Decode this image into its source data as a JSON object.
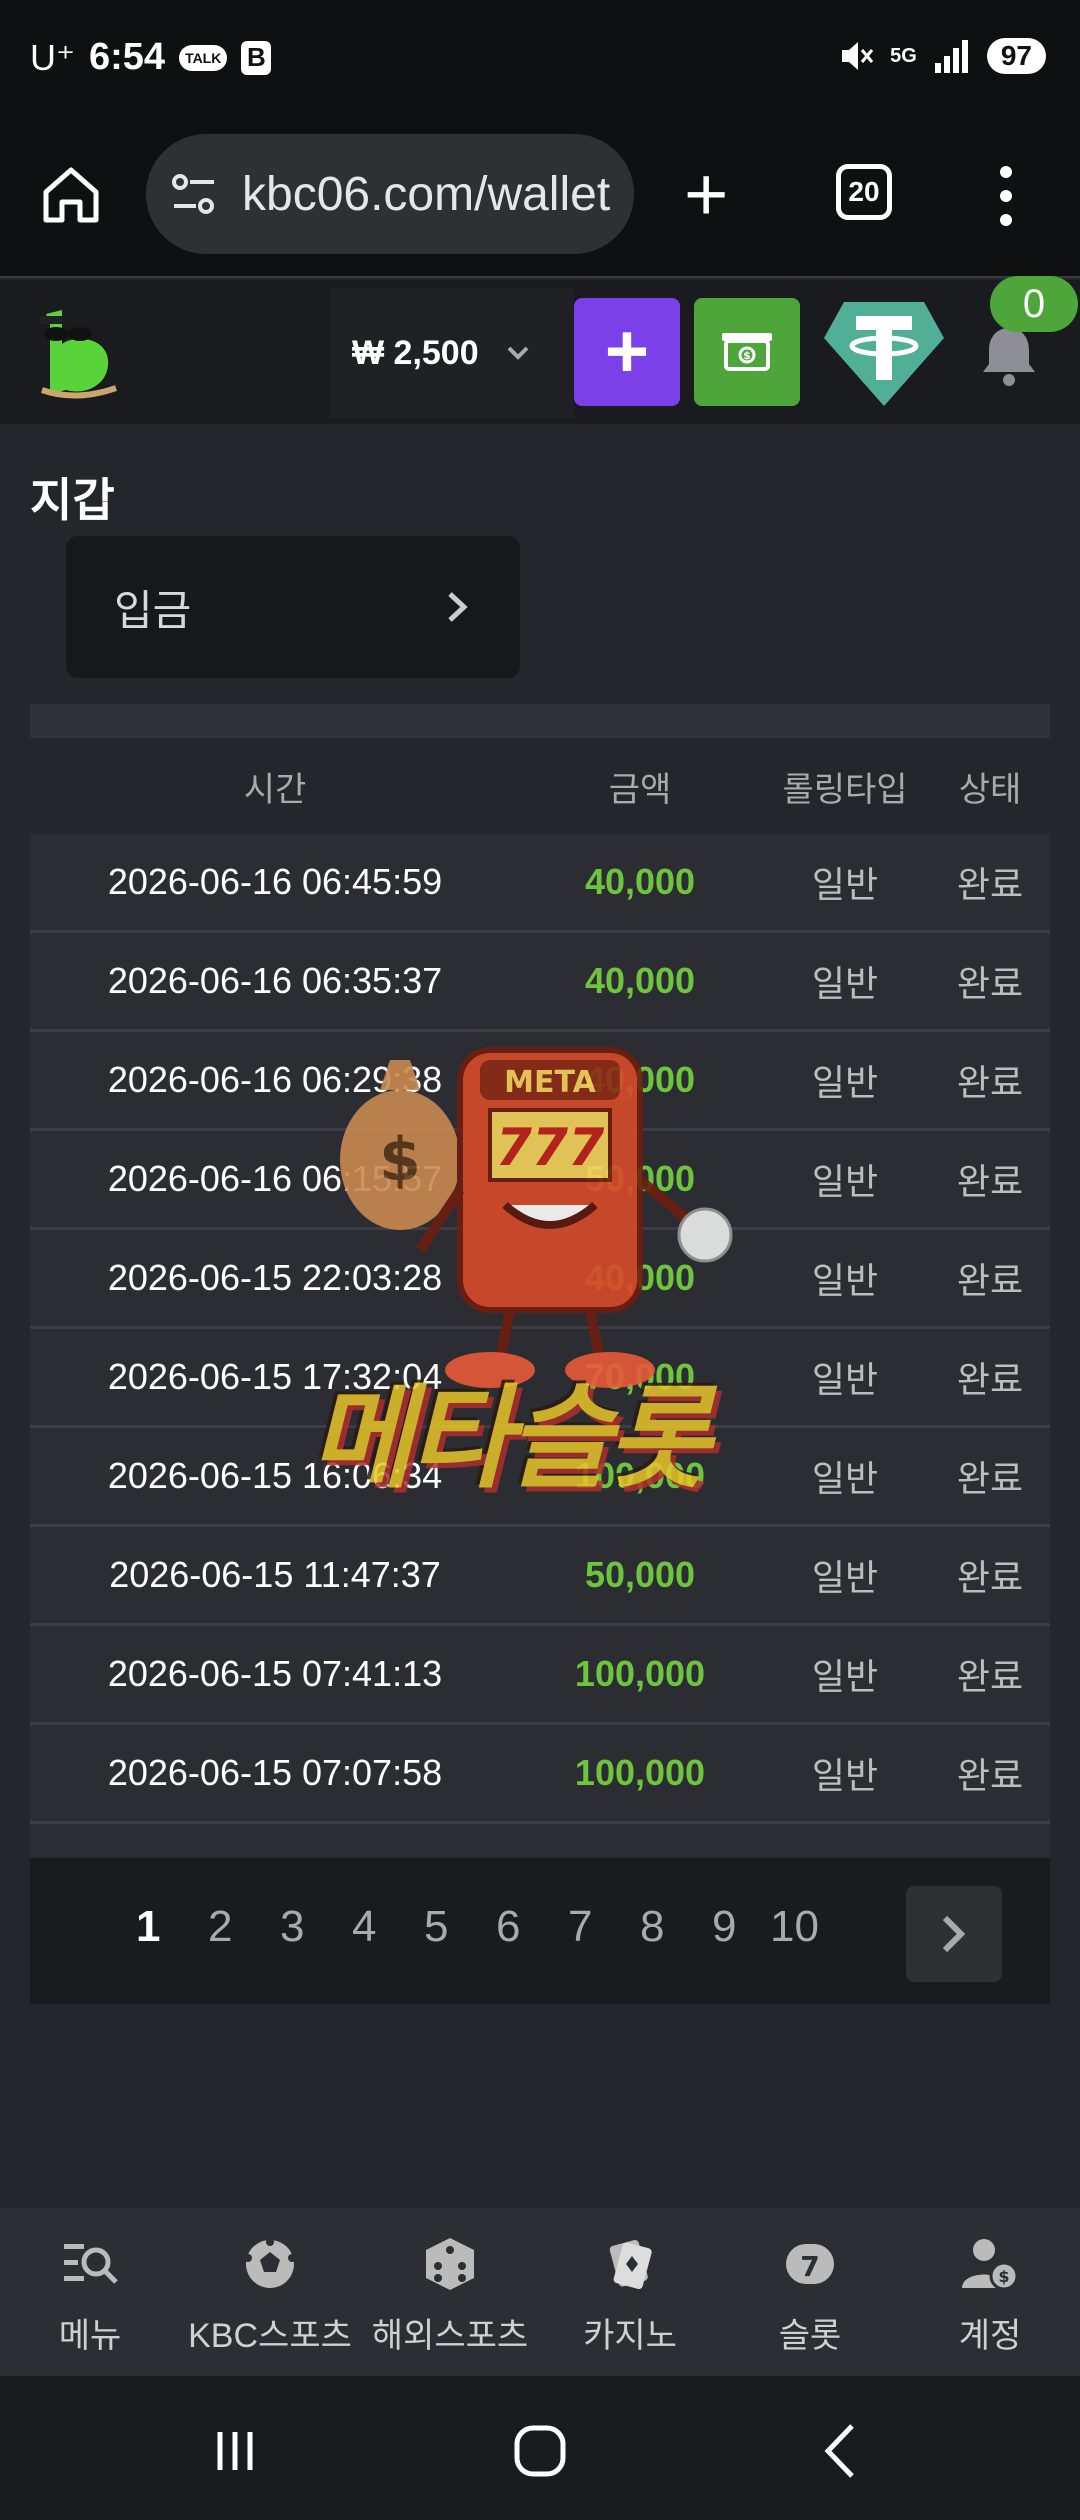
{
  "status_bar": {
    "carrier": "U⁺",
    "time": "6:54",
    "talk_badge": "TALK",
    "b_badge": "B",
    "network": "5G",
    "battery": "97"
  },
  "browser": {
    "url": "kbc06.com/wallet",
    "tab_count": "20"
  },
  "header": {
    "balance": "₩ 2,500",
    "plus_label": "+",
    "notification_count": "0"
  },
  "page": {
    "title": "지갑",
    "deposit_label": "입금"
  },
  "table": {
    "headers": {
      "time": "시간",
      "amount": "금액",
      "rolling": "롤링타입",
      "status": "상태"
    },
    "rows": [
      {
        "time": "2026-06-16 06:45:59",
        "amount": "40,000",
        "rolling": "일반",
        "status": "완료"
      },
      {
        "time": "2026-06-16 06:35:37",
        "amount": "40,000",
        "rolling": "일반",
        "status": "완료"
      },
      {
        "time": "2026-06-16 06:29:38",
        "amount": "40,000",
        "rolling": "일반",
        "status": "완료"
      },
      {
        "time": "2026-06-16 06:15:57",
        "amount": "50,000",
        "rolling": "일반",
        "status": "완료"
      },
      {
        "time": "2026-06-15 22:03:28",
        "amount": "40,000",
        "rolling": "일반",
        "status": "완료"
      },
      {
        "time": "2026-06-15 17:32:04",
        "amount": "70,000",
        "rolling": "일반",
        "status": "완료"
      },
      {
        "time": "2026-06-15 16:06:34",
        "amount": "100,000",
        "rolling": "일반",
        "status": "완료"
      },
      {
        "time": "2026-06-15 11:47:37",
        "amount": "50,000",
        "rolling": "일반",
        "status": "완료"
      },
      {
        "time": "2026-06-15 07:41:13",
        "amount": "100,000",
        "rolling": "일반",
        "status": "완료"
      },
      {
        "time": "2026-06-15 07:07:58",
        "amount": "100,000",
        "rolling": "일반",
        "status": "완료"
      }
    ]
  },
  "pagination": {
    "pages": [
      "1",
      "2",
      "3",
      "4",
      "5",
      "6",
      "7",
      "8",
      "9",
      "10"
    ],
    "current": "1"
  },
  "watermark": {
    "sign": "META",
    "reels": "777",
    "text": "메타슬롯"
  },
  "bottom_nav": {
    "items": [
      {
        "label": "메뉴",
        "icon": "menu-search-icon"
      },
      {
        "label": "KBC스포츠",
        "icon": "soccer-ball-icon"
      },
      {
        "label": "해외스포츠",
        "icon": "dice-icon"
      },
      {
        "label": "카지노",
        "icon": "cards-icon"
      },
      {
        "label": "슬롯",
        "icon": "slot-seven-icon"
      },
      {
        "label": "계정",
        "icon": "account-icon"
      }
    ]
  },
  "colors": {
    "accent_green": "#6ec43d",
    "plus_purple": "#7b40e8",
    "cashier_green": "#4ea63a",
    "tether_teal": "#50af95"
  }
}
